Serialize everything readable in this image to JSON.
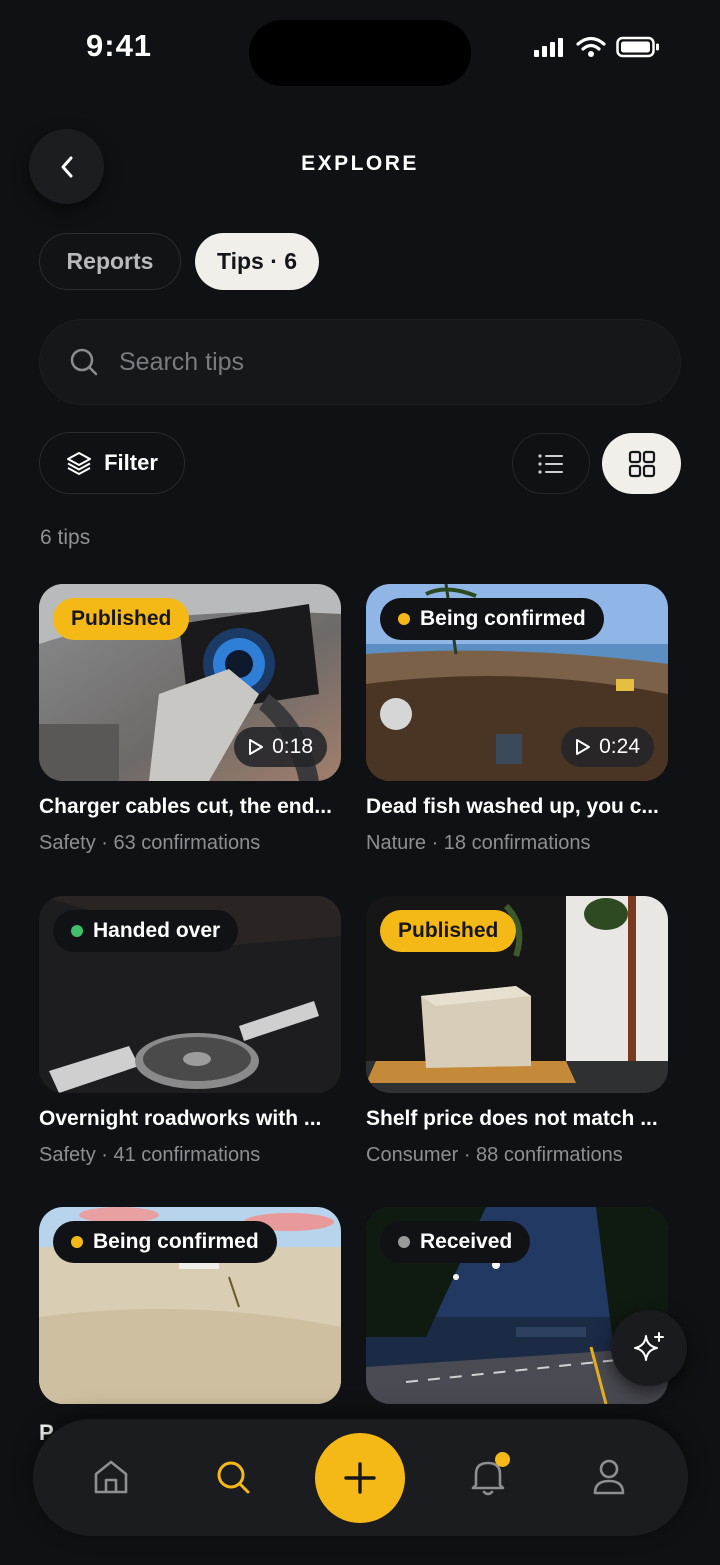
{
  "status_bar": {
    "time": "9:41"
  },
  "header": {
    "title": "EXPLORE"
  },
  "tabs": [
    {
      "label": "Reports",
      "active": false
    },
    {
      "label": "Tips · 6",
      "active": true
    }
  ],
  "search": {
    "placeholder": "Search tips",
    "value": ""
  },
  "filter": {
    "label": "Filter",
    "view_mode": "grid"
  },
  "results": {
    "count_label": "6 tips"
  },
  "colors": {
    "accent": "#f4b917",
    "background": "#101114",
    "handed_over": "#3fbf6a",
    "received": "#9a9a9a"
  },
  "cards": [
    {
      "status": "Published",
      "title": "Charger cables cut, the end...",
      "meta": "Safety · 63 confirmations",
      "duration": "0:18"
    },
    {
      "status": "Being confirmed",
      "title": "Dead fish washed up, you c...",
      "meta": "Nature · 18 confirmations",
      "duration": "0:24"
    },
    {
      "status": "Handed over",
      "title": "Overnight roadworks with ...",
      "meta": "Safety · 41 confirmations"
    },
    {
      "status": "Published",
      "title": "Shelf price does not match ...",
      "meta": "Consumer · 88 confirmations"
    },
    {
      "status": "Being confirmed",
      "title": "",
      "meta": ""
    },
    {
      "status": "Received",
      "title": "",
      "meta": ""
    }
  ],
  "partial_row_text": "P",
  "nav": {
    "items": [
      {
        "name": "home",
        "icon": "home-icon",
        "active": false
      },
      {
        "name": "search",
        "icon": "search-icon",
        "active": true
      },
      {
        "name": "add",
        "icon": "plus-icon",
        "active": false
      },
      {
        "name": "notifications",
        "icon": "bell-icon",
        "active": false,
        "has_badge": true
      },
      {
        "name": "profile",
        "icon": "user-icon",
        "active": false
      }
    ]
  }
}
